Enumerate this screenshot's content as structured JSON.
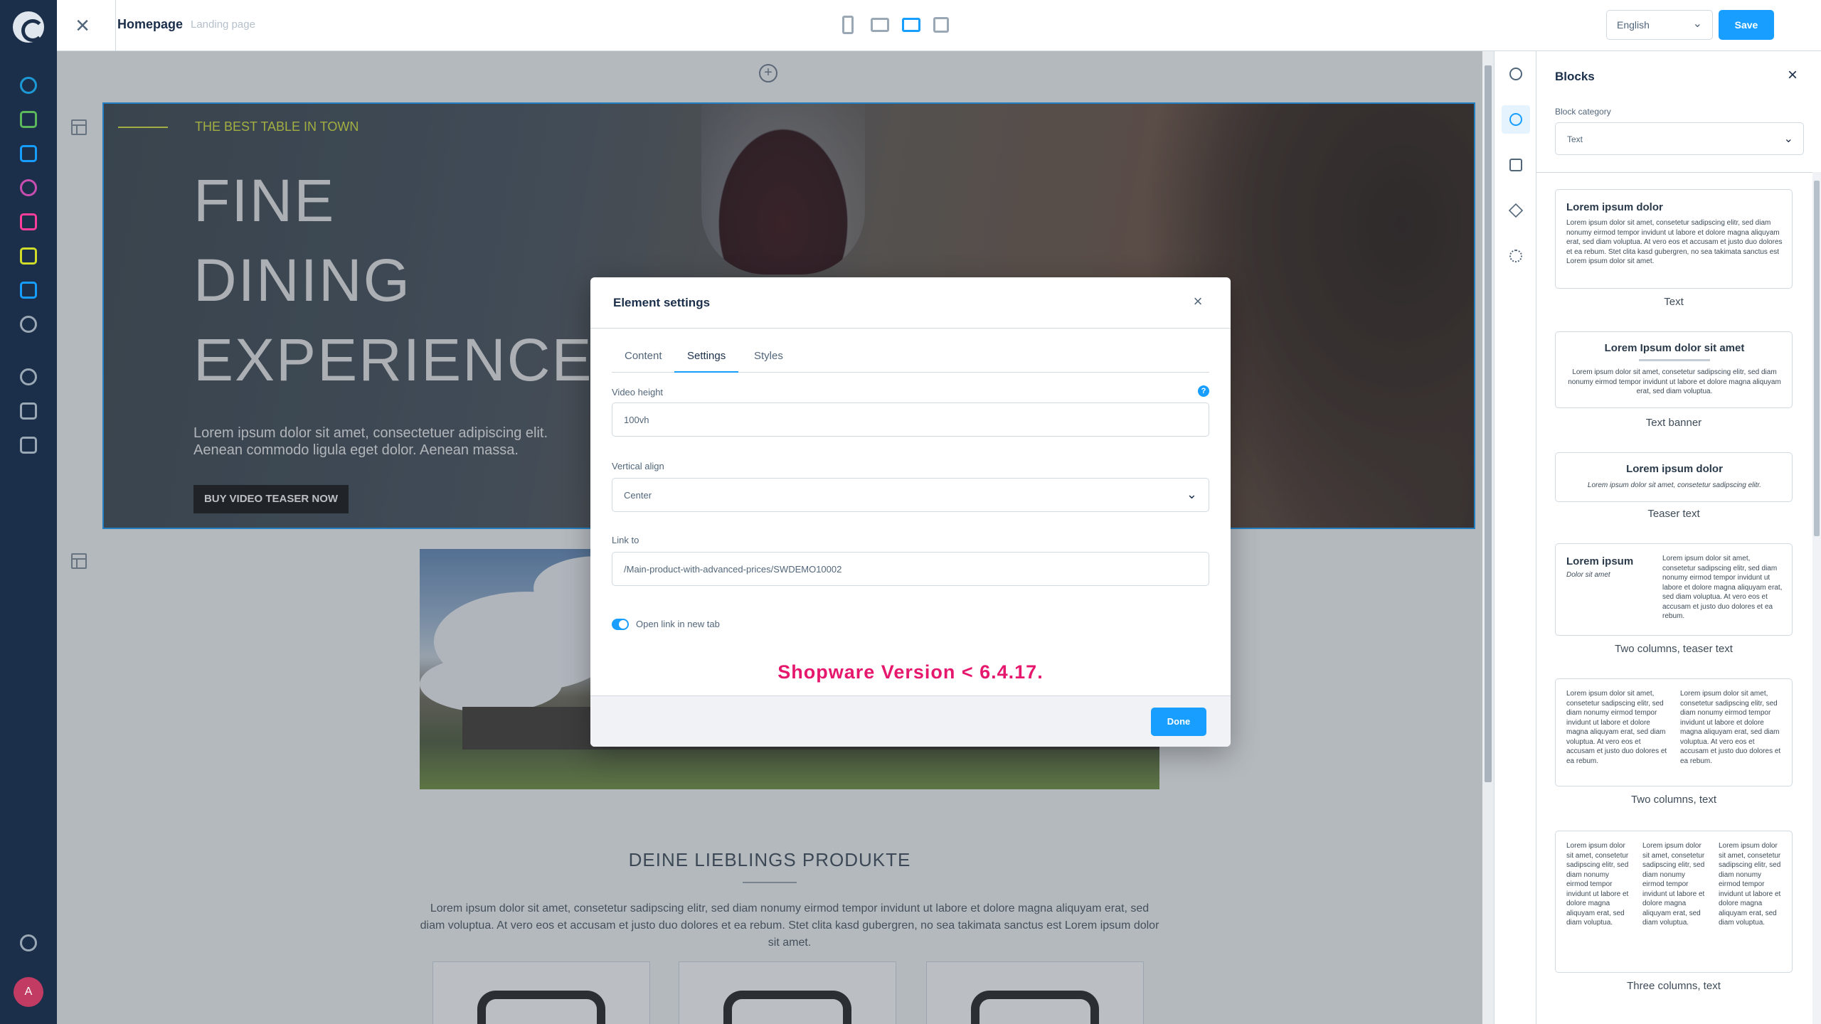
{
  "topbar": {
    "page_title": "Homepage",
    "page_type": "Landing page",
    "language": "English",
    "save_label": "Save"
  },
  "hero": {
    "kicker": "THE BEST TABLE IN TOWN",
    "headline_1": "FINE",
    "headline_2": "DINING",
    "headline_3": "EXPERIENCE",
    "text_1": "Lorem ipsum dolor sit amet, consectetuer adipiscing elit.",
    "text_2": "Aenean commodo ligula eget dolor. Aenean massa.",
    "button": "BUY VIDEO TEASER NOW"
  },
  "products": {
    "title": "DEINE LIEBLINGS PRODUKTE",
    "text": "Lorem ipsum dolor sit amet, consetetur sadipscing elitr, sed diam nonumy eirmod tempor invidunt ut labore et dolore magna aliquyam erat, sed diam voluptua. At vero eos et accusam et justo duo dolores et ea rebum. Stet clita kasd gubergren, no sea takimata sanctus est Lorem ipsum dolor sit amet."
  },
  "modal": {
    "title": "Element settings",
    "tabs": [
      "Content",
      "Settings",
      "Styles"
    ],
    "active_tab": "Settings",
    "video_height_label": "Video height",
    "video_height_value": "100vh",
    "help_icon": "?",
    "vertical_align_label": "Vertical align",
    "vertical_align_value": "Center",
    "link_label": "Link to",
    "link_value": "/Main-product-with-advanced-prices/SWDEMO10002",
    "open_new_tab_label": "Open link in new tab",
    "open_new_tab_enabled": true,
    "version_note": "Shopware Version < 6.4.17.",
    "done_label": "Done"
  },
  "sidebar": {
    "title": "Blocks",
    "category_label": "Block category",
    "category_value": "Text",
    "lorem_long": "Lorem ipsum dolor sit amet, consetetur sadipscing elitr, sed diam nonumy eirmod tempor invidunt ut labore et dolore magna aliquyam erat, sed diam voluptua. At vero eos et accusam et justo duo dolores et ea rebum. Stet clita kasd gubergren, no sea takimata sanctus est Lorem ipsum dolor sit amet.",
    "lorem_short": "Lorem ipsum dolor sit amet, consetetur sadipscing elitr, sed diam nonumy eirmod tempor invidunt ut labore et dolore magna aliquyam erat, sed diam voluptua.",
    "lorem_col": "Lorem ipsum dolor sit amet, consetetur sadipscing elitr, sed diam nonumy eirmod tempor invidunt ut labore et dolore magna aliquyam erat, sed diam voluptua. At vero eos et accusam et justo duo dolores et ea rebum.",
    "lorem_col3": "Lorem ipsum dolor sit amet, consetetur sadipscing elitr, sed diam nonumy eirmod tempor invidunt ut labore et dolore magna aliquyam erat, sed diam voluptua.",
    "teaser_sub": "Lorem ipsum dolor sit amet, consetetur sadipscing elitr.",
    "blocks": [
      {
        "preview_title": "Lorem ipsum dolor",
        "caption": "Text"
      },
      {
        "preview_title": "Lorem Ipsum dolor sit amet",
        "caption": "Text banner"
      },
      {
        "preview_title": "Lorem ipsum dolor",
        "caption": "Teaser text"
      },
      {
        "preview_title": "Lorem ipsum",
        "preview_sub": "Dolor sit amet",
        "caption": "Two columns, teaser text"
      },
      {
        "caption": "Two columns, text"
      },
      {
        "caption": "Three columns, text"
      }
    ]
  },
  "user": {
    "avatar_initial": "A"
  },
  "colors": {
    "accent": "#189eff",
    "nav_bg": "#1b2f4a",
    "version_note": "#e6186e",
    "hero_kicker": "#d9e63a"
  }
}
